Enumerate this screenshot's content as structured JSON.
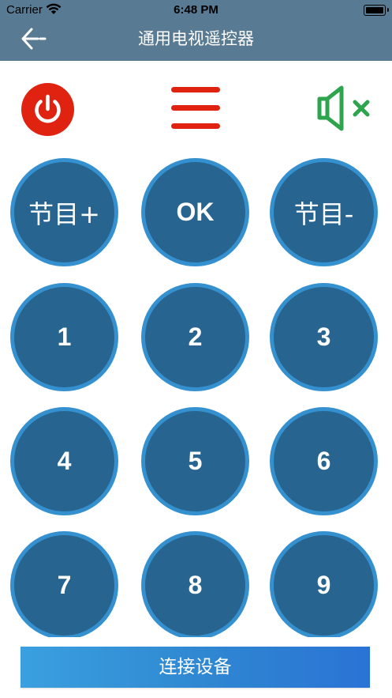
{
  "status_bar": {
    "carrier": "Carrier",
    "time": "6:48 PM"
  },
  "nav": {
    "title": "通用电视遥控器",
    "back_icon": "back-arrow-icon"
  },
  "controls": {
    "power_icon": "power-icon",
    "menu_icon": "menu-icon",
    "mute_icon": "mute-icon",
    "accent_color": "#e02210",
    "mute_color": "#2ea44f"
  },
  "keys": {
    "channel_up": "节目+",
    "ok": "OK",
    "channel_down": "节目-",
    "digits": [
      "1",
      "2",
      "3",
      "4",
      "5",
      "6",
      "7",
      "8",
      "9"
    ]
  },
  "connect_button": {
    "label": "连接设备"
  },
  "colors": {
    "nav_bg": "#587a92",
    "key_fill": "#27648f",
    "key_ring": "#3590cf",
    "button_bg": "#3aa0df"
  }
}
